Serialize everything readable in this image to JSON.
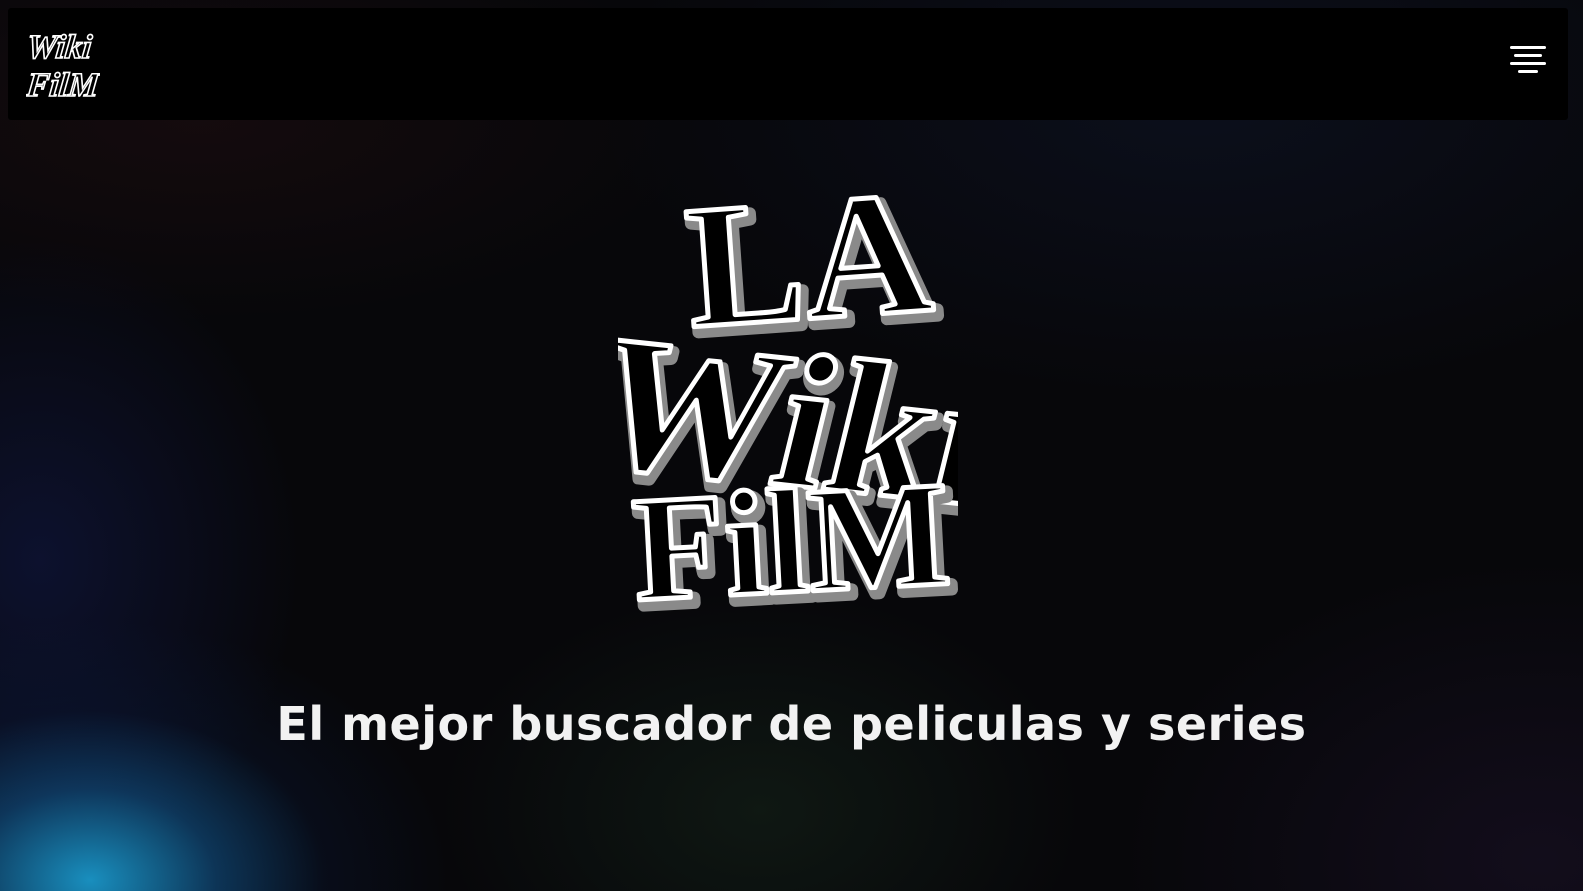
{
  "navbar": {
    "logo": {
      "line1": "Wiki",
      "line2": "FilM"
    },
    "menu_icon": "hamburger-menu-icon"
  },
  "hero": {
    "logo": {
      "line1": "LA",
      "line2": "Wiki",
      "line3": "FilM"
    },
    "tagline": "El mejor buscador de peliculas y series"
  },
  "colors": {
    "navbar_bg": "#000000",
    "text": "#f2f2f2",
    "glow_blue": "#1a96c8"
  }
}
